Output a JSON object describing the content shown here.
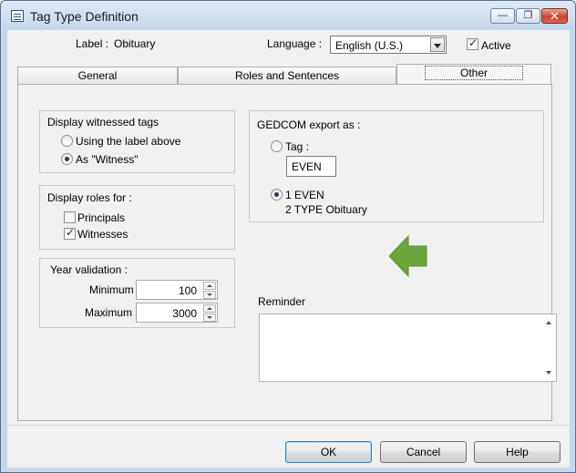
{
  "window": {
    "title": "Tag Type Definition",
    "controls": {
      "minimize": "—",
      "maximize": "❐",
      "close": "✕"
    }
  },
  "header": {
    "label_caption": "Label :",
    "label_value": "Obituary",
    "language_caption": "Language :",
    "language_value": "English (U.S.)",
    "active_label": "Active",
    "active_checked": true
  },
  "tabs": [
    {
      "label": "General",
      "active": false
    },
    {
      "label": "Roles and Sentences",
      "active": false
    },
    {
      "label": "Other",
      "active": true
    }
  ],
  "witnessed": {
    "title": "Display witnessed tags",
    "options": [
      {
        "label": "Using the label above",
        "checked": false
      },
      {
        "label": "As \"Witness\"",
        "checked": true
      }
    ]
  },
  "roles": {
    "title": "Display roles for :",
    "options": [
      {
        "label": "Principals",
        "checked": false
      },
      {
        "label": "Witnesses",
        "checked": true
      }
    ]
  },
  "year_validation": {
    "title": "Year validation :",
    "minimum_label": "Minimum :",
    "minimum_value": "100",
    "maximum_label": "Maximum :",
    "maximum_value": "3000"
  },
  "gedcom": {
    "title": "GEDCOM export as :",
    "tag_label": "Tag :",
    "tag_value": "EVEN",
    "tag_checked": false,
    "option2_line1": "1 EVEN",
    "option2_line2": "2 TYPE Obituary",
    "option2_checked": true
  },
  "reminder": {
    "label": "Reminder",
    "value": ""
  },
  "buttons": {
    "ok": "OK",
    "cancel": "Cancel",
    "help": "Help"
  },
  "colors": {
    "accent_arrow": "#6aa43a",
    "title_bar": "#c5d6ea",
    "close_button": "#c8452f"
  }
}
